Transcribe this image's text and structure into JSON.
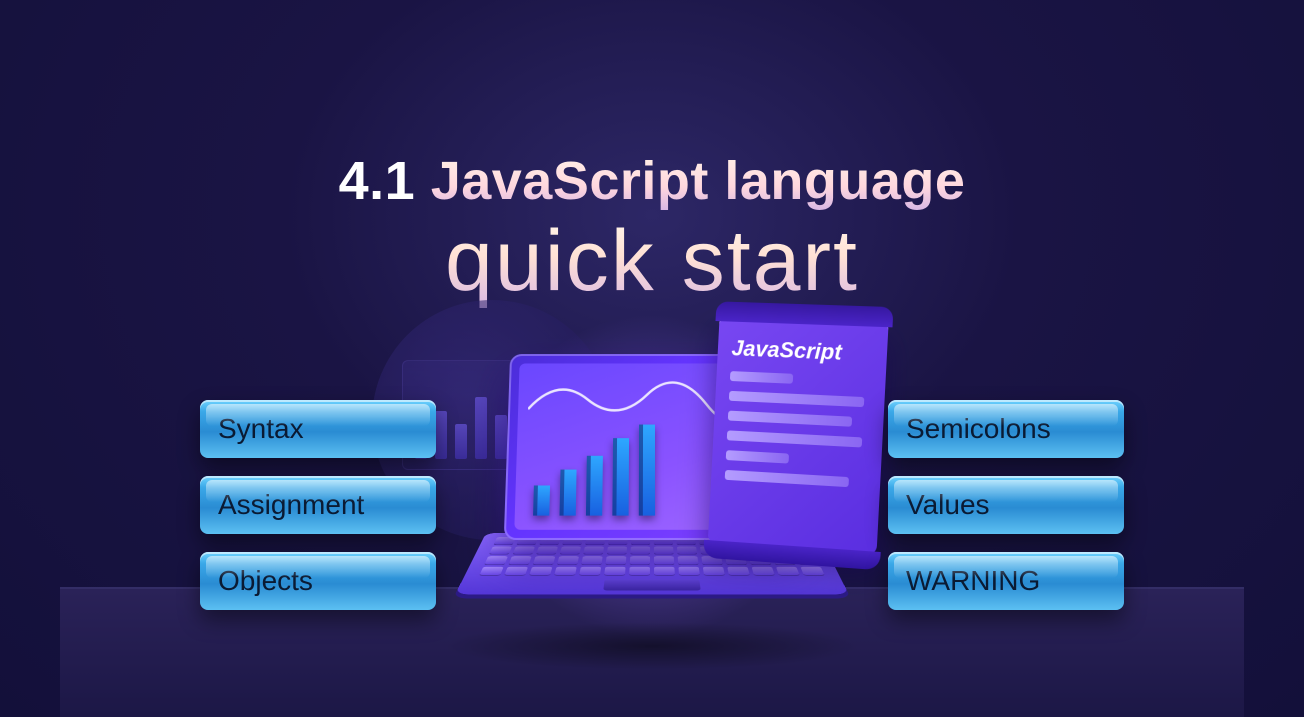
{
  "title": {
    "number": "4.1",
    "main": "JavaScript language",
    "sub": "quick  start"
  },
  "illustration": {
    "doc_label": "JavaScript"
  },
  "pills": {
    "left": [
      {
        "label": "Syntax"
      },
      {
        "label": "Assignment"
      },
      {
        "label": "Objects"
      }
    ],
    "right": [
      {
        "label": "Semicolons"
      },
      {
        "label": "Values"
      },
      {
        "label": "WARNING"
      }
    ]
  }
}
